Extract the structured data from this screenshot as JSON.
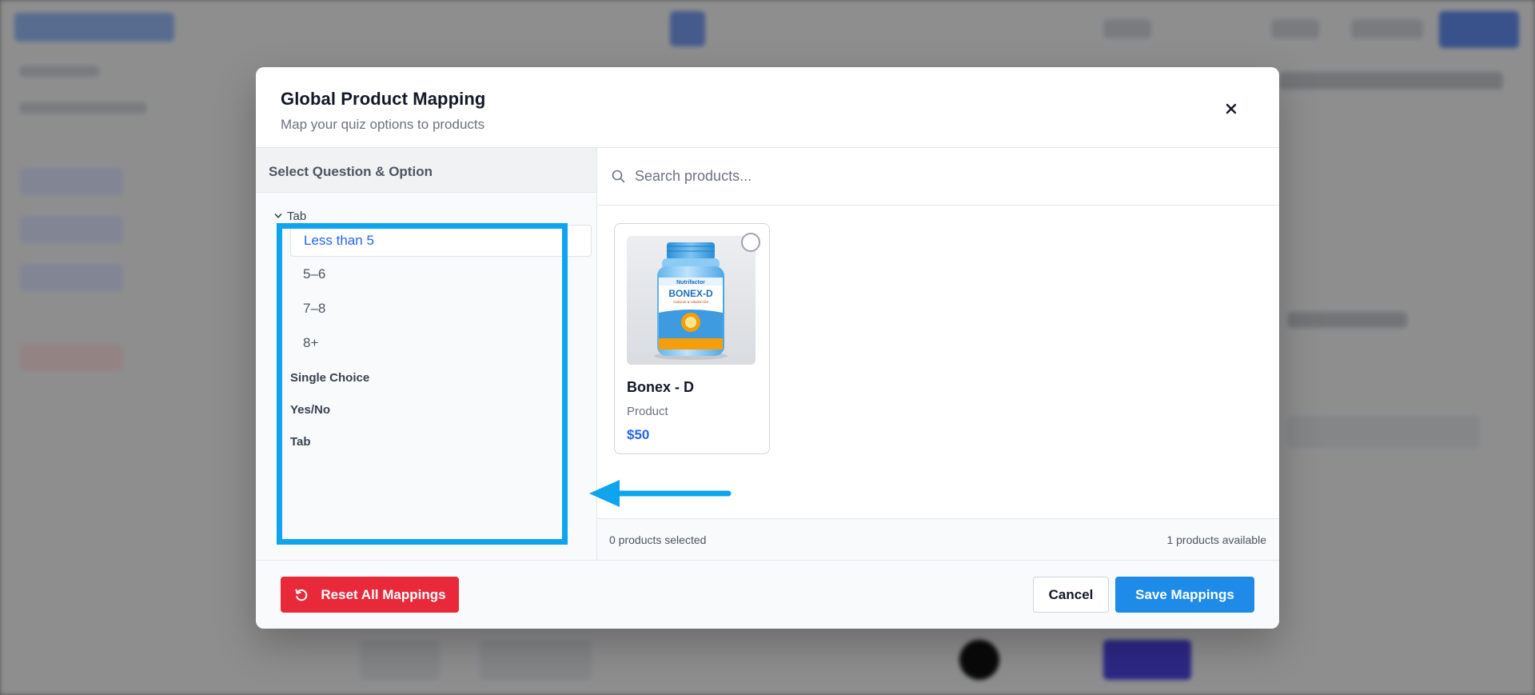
{
  "modal": {
    "title": "Global Product Mapping",
    "subtitle": "Map your quiz options to products",
    "close_icon": "close-icon"
  },
  "left_panel": {
    "heading": "Select Question & Option",
    "expanded_group": "Tab",
    "options": [
      "Less than 5",
      "5–6",
      "7–8",
      "8+"
    ],
    "selected_option": "Less than 5",
    "questions": [
      "Single Choice",
      "Yes/No",
      "Tab"
    ]
  },
  "search": {
    "placeholder": "Search products...",
    "icon": "search-icon"
  },
  "products": [
    {
      "name": "Bonex - D",
      "type": "Product",
      "price": "$50",
      "selected": false
    }
  ],
  "product_image_text": {
    "brand": "Nutrifactor",
    "name": "BONEX-D",
    "tagline": "Calcium & Vitamin D3"
  },
  "status": {
    "selected_count": "0 products selected",
    "available_count": "1 products available"
  },
  "footer": {
    "reset_label": "Reset All Mappings",
    "cancel_label": "Cancel",
    "save_label": "Save Mappings"
  },
  "colors": {
    "accent": "#2563eb",
    "save_button": "#1f8be8",
    "reset_button": "#e8293a",
    "annotation": "#0ea5ee"
  }
}
